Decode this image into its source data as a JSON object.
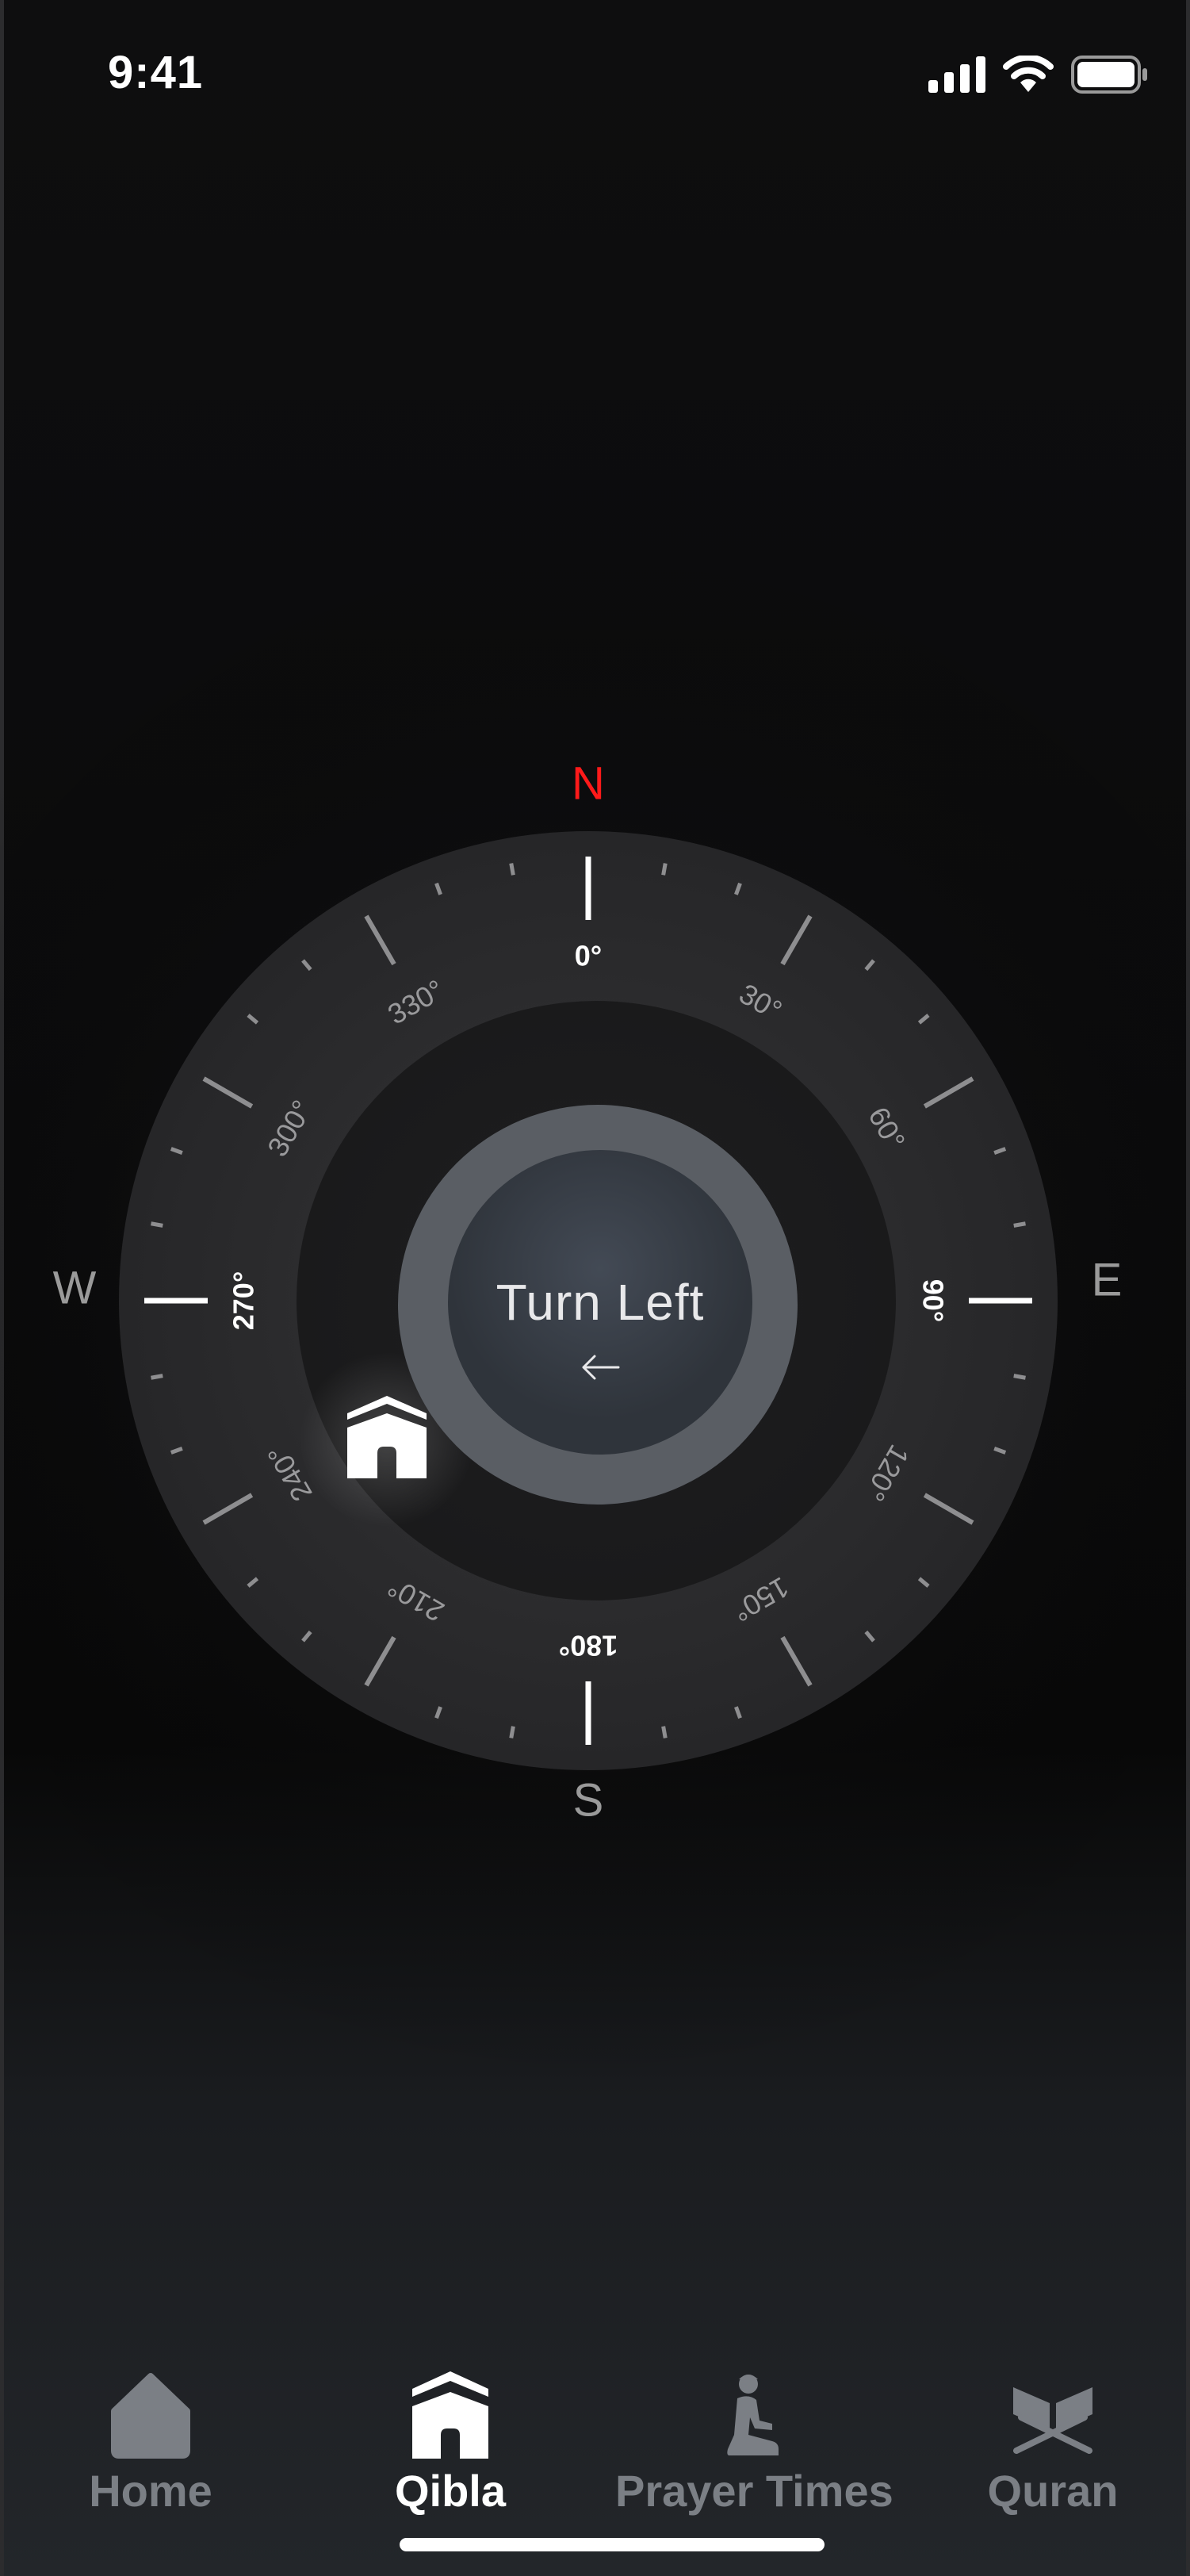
{
  "status_bar": {
    "time": "9:41"
  },
  "compass": {
    "directions": {
      "north": "N",
      "east": "E",
      "south": "S",
      "west": "W"
    },
    "degree_labels": [
      "0°",
      "30°",
      "60°",
      "90°",
      "120°",
      "150°",
      "180°",
      "210°",
      "240°",
      "270°",
      "300°",
      "330°"
    ],
    "instruction": "Turn Left",
    "instruction_arrow": "left-arrow-icon",
    "qibla_marker_icon": "kaaba-icon"
  },
  "tab_bar": {
    "tabs": [
      {
        "label": "Home",
        "icon": "home-icon",
        "active": false
      },
      {
        "label": "Qibla",
        "icon": "kaaba-icon",
        "active": true
      },
      {
        "label": "Prayer Times",
        "icon": "praying-person-icon",
        "active": false
      },
      {
        "label": "Quran",
        "icon": "quran-book-icon",
        "active": false
      }
    ]
  },
  "colors": {
    "north": "#ff1a1a",
    "background": "#0b0b0c",
    "ring": "#2b2b2d",
    "inner_disc": "#3a4048",
    "tab_inactive": "#7b7f85",
    "tab_active": "#ffffff"
  }
}
